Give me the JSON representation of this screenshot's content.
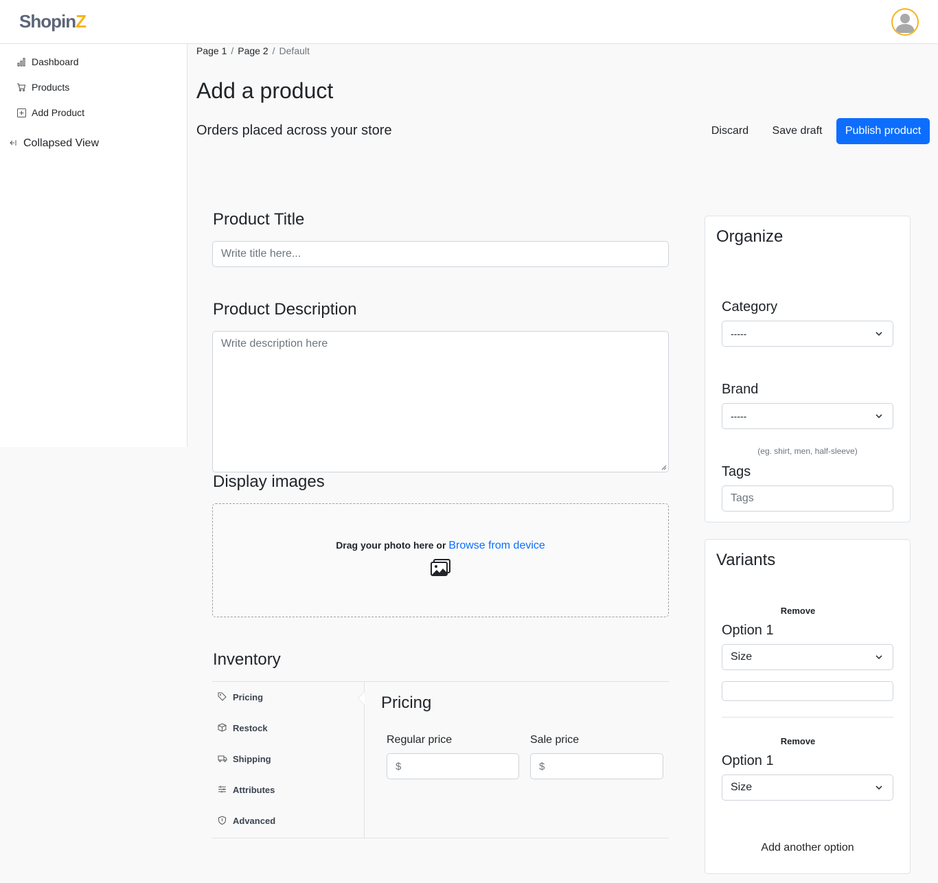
{
  "header": {
    "logo_main": "Shopin",
    "logo_accent": "Z"
  },
  "sidebar": {
    "items": [
      {
        "label": "Dashboard",
        "icon": "bar-chart-icon"
      },
      {
        "label": "Products",
        "icon": "cart-icon"
      },
      {
        "label": "Add Product",
        "icon": "plus-square-icon"
      }
    ],
    "collapse_label": "Collapsed View"
  },
  "breadcrumb": {
    "page1": "Page 1",
    "page2": "Page 2",
    "current": "Default",
    "separator": "/"
  },
  "page": {
    "title": "Add a product",
    "subtitle": "Orders placed across your store",
    "discard": "Discard",
    "save_draft": "Save draft",
    "publish": "Publish product"
  },
  "form": {
    "title_label": "Product Title",
    "title_placeholder": "Write title here...",
    "desc_label": "Product Description",
    "desc_placeholder": "Write description here",
    "images_label": "Display images",
    "drop_text": "Drag your photo here or",
    "browse_link": "Browse from device"
  },
  "inventory": {
    "title": "Inventory",
    "tabs": [
      {
        "label": "Pricing",
        "icon": "tag-icon"
      },
      {
        "label": "Restock",
        "icon": "box-icon"
      },
      {
        "label": "Shipping",
        "icon": "truck-icon"
      },
      {
        "label": "Attributes",
        "icon": "sliders-icon"
      },
      {
        "label": "Advanced",
        "icon": "shield-icon"
      }
    ],
    "pricing_title": "Pricing",
    "regular_label": "Regular price",
    "sale_label": "Sale price",
    "currency_placeholder": "$"
  },
  "organize": {
    "title": "Organize",
    "category_label": "Category",
    "category_value": "-----",
    "brand_label": "Brand",
    "brand_value": "-----",
    "tags_hint": "(eg. shirt, men, half-sleeve)",
    "tags_label": "Tags",
    "tags_placeholder": "Tags"
  },
  "variants": {
    "title": "Variants",
    "options": [
      {
        "remove": "Remove",
        "label": "Option 1",
        "value": "Size"
      },
      {
        "remove": "Remove",
        "label": "Option 1",
        "value": "Size"
      }
    ],
    "add_option": "Add another option"
  },
  "colors": {
    "primary": "#0d6efd",
    "accent": "#f5b41e"
  }
}
